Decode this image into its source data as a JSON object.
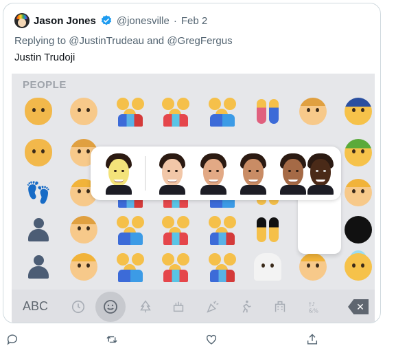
{
  "tweet": {
    "author_name": "Jason Jones",
    "handle": "@jonesville",
    "separator": "·",
    "date": "Feb 2",
    "replying_prefix": "Replying to",
    "reply_user_1": "@JustinTrudeau",
    "reply_and": "and",
    "reply_user_2": "@GregFergus",
    "text": "Justin Trudoji"
  },
  "media": {
    "section_label": "PEOPLE",
    "keyboard": {
      "abc_label": "ABC",
      "selected_category": "smileys"
    },
    "skin_tone_variants": [
      "yellow",
      "light",
      "medium-light",
      "medium",
      "medium-dark",
      "dark"
    ]
  },
  "colors": {
    "accent": "#1d9bf0",
    "muted": "#536471",
    "border": "#cfd9de",
    "keyboard_bg": "#e6e7ea"
  },
  "actions": [
    "reply-icon",
    "retweet-icon",
    "like-icon",
    "share-icon"
  ]
}
